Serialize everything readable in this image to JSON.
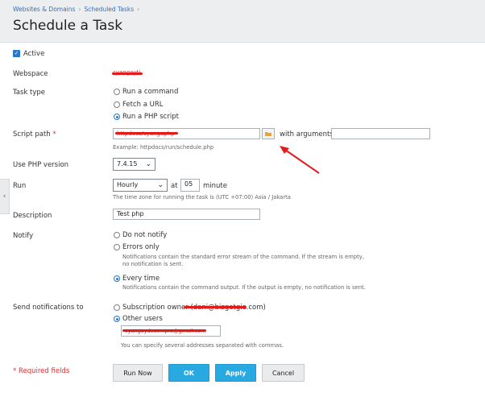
{
  "breadcrumb": [
    "Websites & Domains",
    "Scheduled Tasks"
  ],
  "page_title": "Schedule a Task",
  "active_label": "Active",
  "webspace": {
    "label": "Webspace",
    "value": "cyangayti"
  },
  "task_type": {
    "label": "Task type",
    "options": [
      "Run a command",
      "Fetch a URL",
      "Run a PHP script"
    ],
    "selected": "Run a PHP script"
  },
  "script_path": {
    "label": "Script path",
    "required_mark": "*",
    "value": "httpdocs/cyangaphp",
    "with_args_label": "with arguments",
    "args_value": "",
    "example": "Example: httpdocs/run/schedule.php"
  },
  "php_version": {
    "label": "Use PHP version",
    "value": "7.4.15"
  },
  "run": {
    "label": "Run",
    "frequency": "Hourly",
    "at_label": "at",
    "minute_value": "05",
    "minute_label": "minute",
    "timezone_note": "The time zone for running the task is (UTC +07:00) Asia / Jakarta"
  },
  "description": {
    "label": "Description",
    "value": "Test php"
  },
  "notify": {
    "label": "Notify",
    "options": [
      {
        "label": "Do not notify",
        "note": ""
      },
      {
        "label": "Errors only",
        "note_line1": "Notifications contain the standard error stream of the command. If the stream is empty,",
        "note_line2": "no notification is sent."
      },
      {
        "label": "Every time",
        "note": "Notifications contain the command output. If the output is empty, no notification is sent."
      }
    ],
    "selected": "Every time"
  },
  "send_to": {
    "label": "Send notifications to",
    "subscription_owner": "Subscription owner",
    "owner_email": "(dani@bizgetgio.com)",
    "other_users": "Other users",
    "email_value": "cyangaydesempro@gmail.com",
    "hint": "You can specify several addresses separated with commas."
  },
  "required_note": "* Required fields",
  "buttons": {
    "run_now": "Run Now",
    "ok": "OK",
    "apply": "Apply",
    "cancel": "Cancel"
  },
  "colors": {
    "accent": "#2a77c4",
    "primary_button": "#28a9e1",
    "annotation": "#e21b1b"
  },
  "icons": [
    "folder-icon",
    "checkbox-checked-icon",
    "chevron-down-icon",
    "collapse-left-icon",
    "annotation-arrow"
  ]
}
